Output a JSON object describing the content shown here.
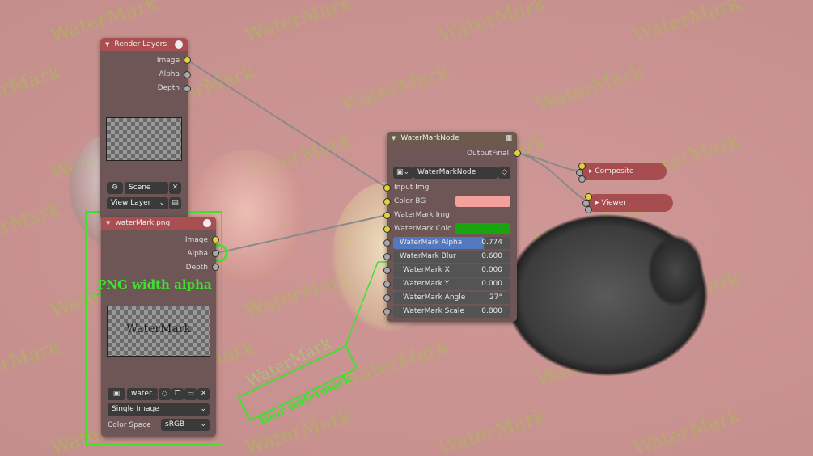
{
  "background_watermarks": [
    "WaterMark"
  ],
  "render_layers": {
    "title": "Render Layers",
    "outputs": [
      "Image",
      "Alpha",
      "Depth"
    ],
    "scene": "Scene",
    "view_layer": "View Layer"
  },
  "image_node": {
    "title": "waterMark.png",
    "outputs": [
      "Image",
      "Alpha",
      "Depth"
    ],
    "preview_text": "WaterMark",
    "image_name": "water...",
    "source": "Single Image",
    "color_space_label": "Color Space",
    "color_space": "sRGB"
  },
  "watermark_node": {
    "title": "WaterMarkNode",
    "output": "OutputFinal",
    "node_group": "WaterMarkNode",
    "inputs": {
      "input_img": "Input Img",
      "color_bg": "Color BG",
      "watermark_img": "WaterMark Img",
      "watermark_color": "WaterMark Colo"
    },
    "params": [
      {
        "label": "WaterMark Alpha",
        "value": "0.774"
      },
      {
        "label": "WaterMark Blur",
        "value": "0.600"
      },
      {
        "label": "WaterMark X",
        "value": "0.000"
      },
      {
        "label": "WaterMark Y",
        "value": "0.000"
      },
      {
        "label": "WaterMark Angle",
        "value": "27°"
      },
      {
        "label": "WaterMark Scale",
        "value": "0.800"
      }
    ],
    "colors": {
      "bg": "#f4a09d",
      "watermark": "#19a50e",
      "alpha_bar": "#5278c0"
    }
  },
  "composite_label": "Composite",
  "viewer_label": "Viewer",
  "annotations": {
    "png_note": "PNG width alpha",
    "blur_note": "Blur watermark",
    "blur_sample": "WaterMark"
  }
}
